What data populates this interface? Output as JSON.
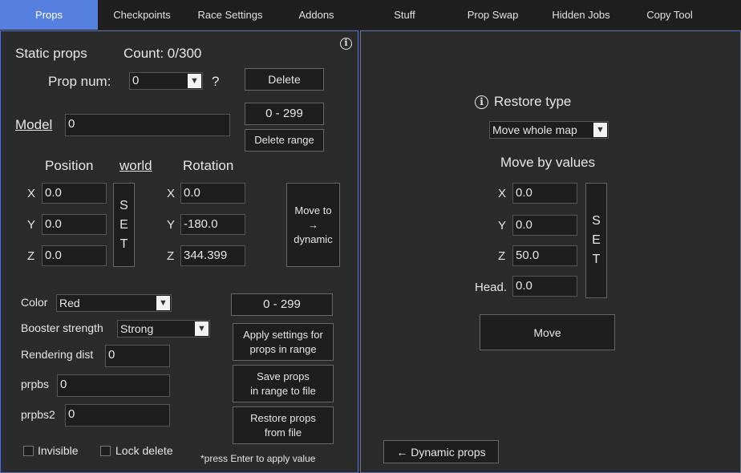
{
  "tabs": [
    "Props",
    "Checkpoints",
    "Race Settings",
    "Addons",
    "Stuff",
    "Prop Swap",
    "Hidden Jobs",
    "Copy Tool"
  ],
  "left": {
    "static_props": "Static props",
    "count": "Count: 0/300",
    "prop_num_label": "Prop num:",
    "prop_num_value": "0",
    "question": "?",
    "delete_btn": "Delete",
    "range_value": "0 - 299",
    "delete_range_btn": "Delete range",
    "model_label": "Model",
    "model_value": "0",
    "position_label": "Position",
    "world_label": "world",
    "rotation_label": "Rotation",
    "pos": {
      "x_label": "X",
      "x": "0.0",
      "y_label": "Y",
      "y": "0.0",
      "z_label": "Z",
      "z": "0.0"
    },
    "rot": {
      "x_label": "X",
      "x": "0.0",
      "y_label": "Y",
      "y": "-180.0",
      "z_label": "Z",
      "z": "344.399"
    },
    "set_letters": [
      "S",
      "E",
      "T"
    ],
    "move_to_dynamic": [
      "Move to",
      "→",
      "dynamic"
    ],
    "color_label": "Color",
    "color_value": "Red",
    "booster_label": "Booster strength",
    "booster_value": "Strong",
    "render_label": "Rendering dist",
    "render_value": "0",
    "prpbs_label": "prpbs",
    "prpbs_value": "0",
    "prpbs2_label": "prpbs2",
    "prpbs2_value": "0",
    "range2_value": "0 - 299",
    "apply_btn": [
      "Apply settings for",
      "props in range"
    ],
    "save_btn": [
      "Save props",
      "in range to file"
    ],
    "restore_btn": [
      "Restore props",
      "from file"
    ],
    "invisible_label": "Invisible",
    "lock_delete_label": "Lock delete",
    "hint": "*press Enter to apply value"
  },
  "right": {
    "restore_type_label": "Restore type",
    "restore_type_value": "Move whole map",
    "move_by_values": "Move by values",
    "x_label": "X",
    "x": "0.0",
    "y_label": "Y",
    "y": "0.0",
    "z_label": "Z",
    "z": "50.0",
    "head_label": "Head.",
    "head": "0.0",
    "set_letters": [
      "S",
      "E",
      "T"
    ],
    "move_btn": "Move",
    "dynamic_props_btn": "← Dynamic props"
  }
}
